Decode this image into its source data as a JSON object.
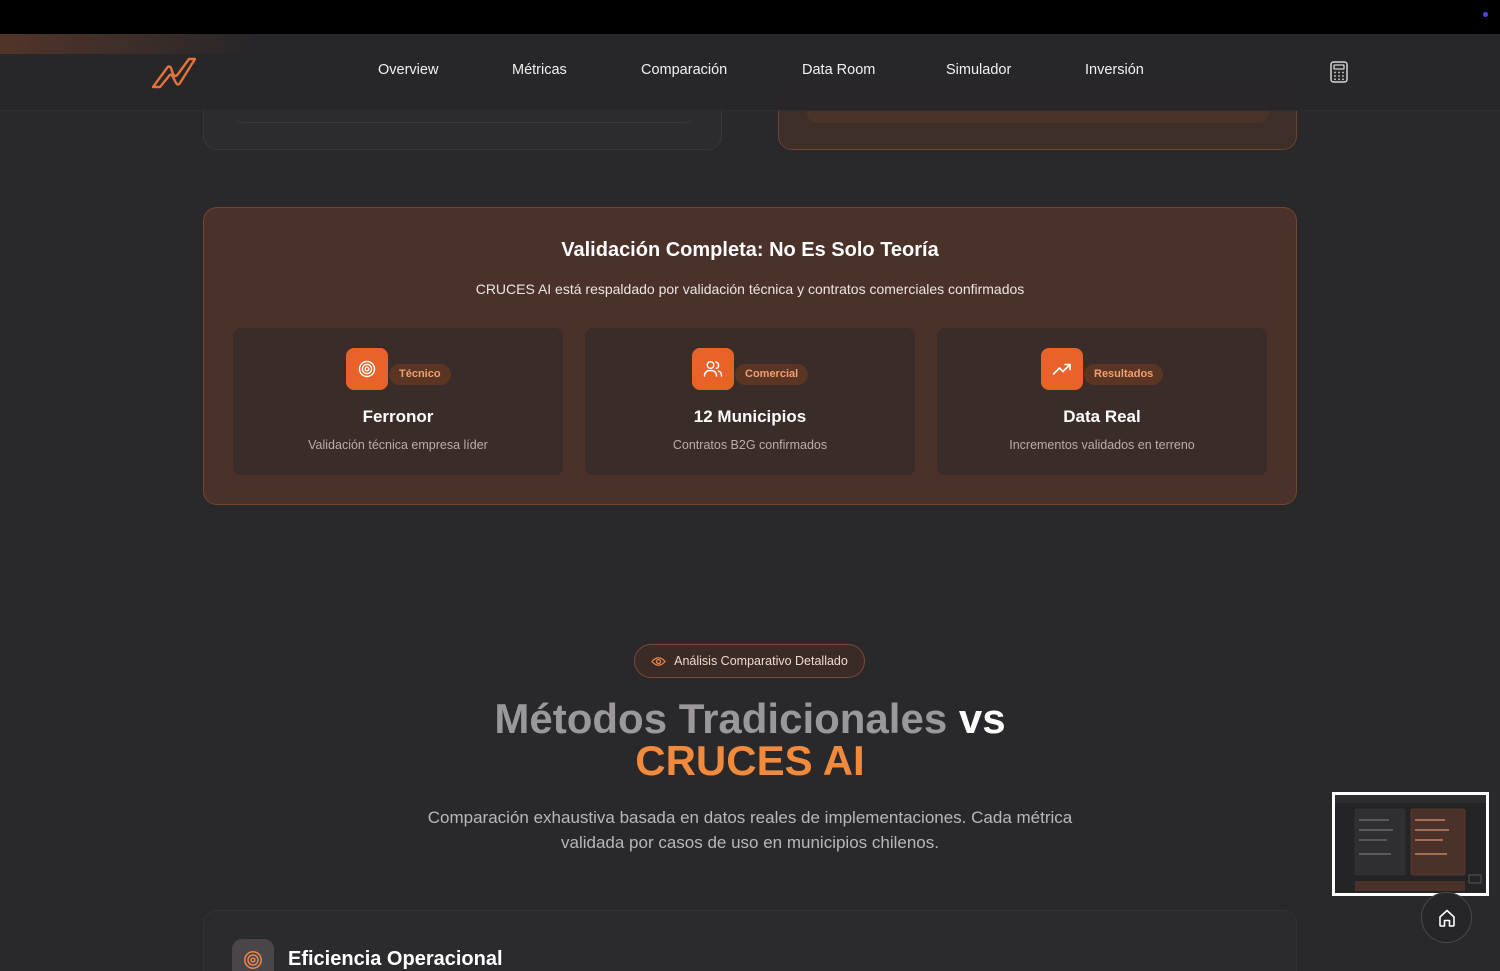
{
  "nav": {
    "items": [
      "Overview",
      "Métricas",
      "Comparación",
      "Data Room",
      "Simulador",
      "Inversión"
    ],
    "logo_icon": "cruces-logo-icon",
    "calculator_icon": "calculator-icon"
  },
  "validation": {
    "title": "Validación Completa: No Es Solo Teoría",
    "subtitle": "CRUCES AI está respaldado por validación técnica y contratos comerciales confirmados",
    "cards": [
      {
        "badge": "Técnico",
        "title": "Ferronor",
        "desc": "Validación técnica empresa líder",
        "icon": "target-icon"
      },
      {
        "badge": "Comercial",
        "title": "12 Municipios",
        "desc": "Contratos B2G confirmados",
        "icon": "users-icon"
      },
      {
        "badge": "Resultados",
        "title": "Data Real",
        "desc": "Incrementos validados en terreno",
        "icon": "trending-up-icon"
      }
    ]
  },
  "comparison": {
    "pill": "Análisis Comparativo Detallado",
    "heading_part1": "Métodos Tradicionales",
    "heading_vs": "vs",
    "heading_part2": "CRUCES AI",
    "description": "Comparación exhaustiva basada en datos reales de implementaciones. Cada métrica validada por casos de uso en municipios chilenos."
  },
  "bottom_card": {
    "title": "Eficiencia Operacional",
    "icon": "target-icon"
  },
  "colors": {
    "accent": "#e8632a",
    "accent_text": "#f08a3c",
    "background": "#29282b"
  }
}
